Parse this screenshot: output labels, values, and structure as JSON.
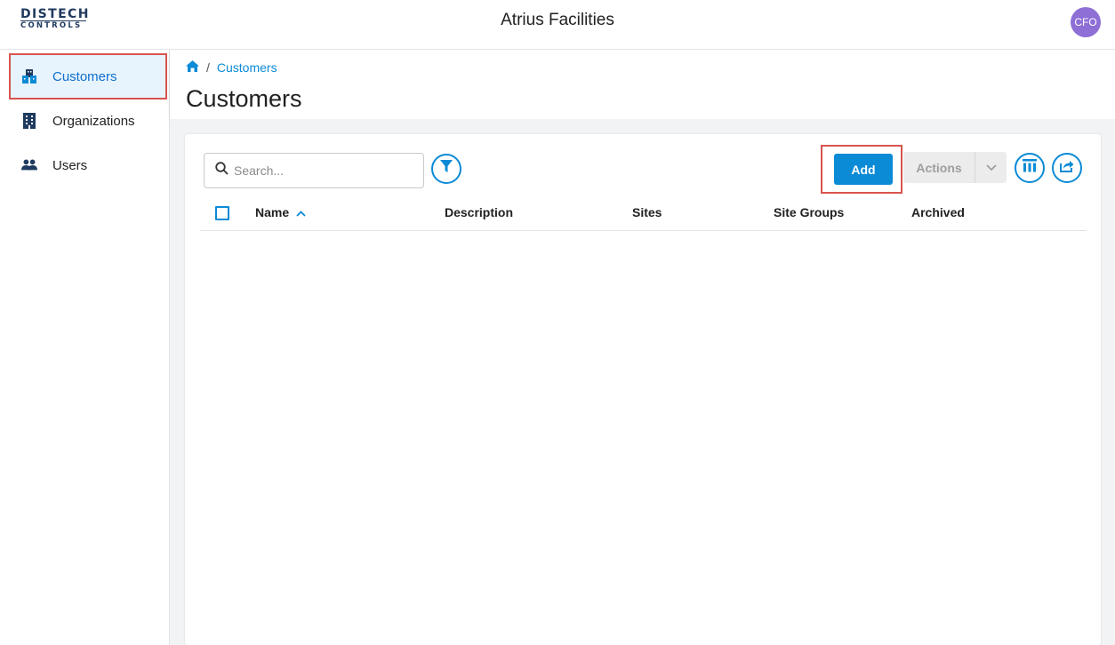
{
  "header": {
    "logo_top": "DISTECH",
    "logo_bottom": "CONTROLS",
    "app_title": "Atrius Facilities",
    "avatar_initials": "CFO"
  },
  "sidebar": {
    "items": [
      {
        "label": "Customers",
        "icon": "customers-icon",
        "active": true
      },
      {
        "label": "Organizations",
        "icon": "building-icon",
        "active": false
      },
      {
        "label": "Users",
        "icon": "users-icon",
        "active": false
      }
    ]
  },
  "breadcrumb": {
    "home_icon": "home-icon",
    "separator": "/",
    "current": "Customers"
  },
  "page": {
    "title": "Customers"
  },
  "toolbar": {
    "search_placeholder": "Search...",
    "add_label": "Add",
    "actions_label": "Actions"
  },
  "table": {
    "columns": [
      "Name",
      "Description",
      "Sites",
      "Site Groups",
      "Archived"
    ],
    "sort_column": "Name",
    "sort_direction": "ascending",
    "rows": []
  },
  "colors": {
    "accent": "#0b8ad6",
    "highlight_box": "#d9534f",
    "avatar": "#8e6fd6"
  }
}
